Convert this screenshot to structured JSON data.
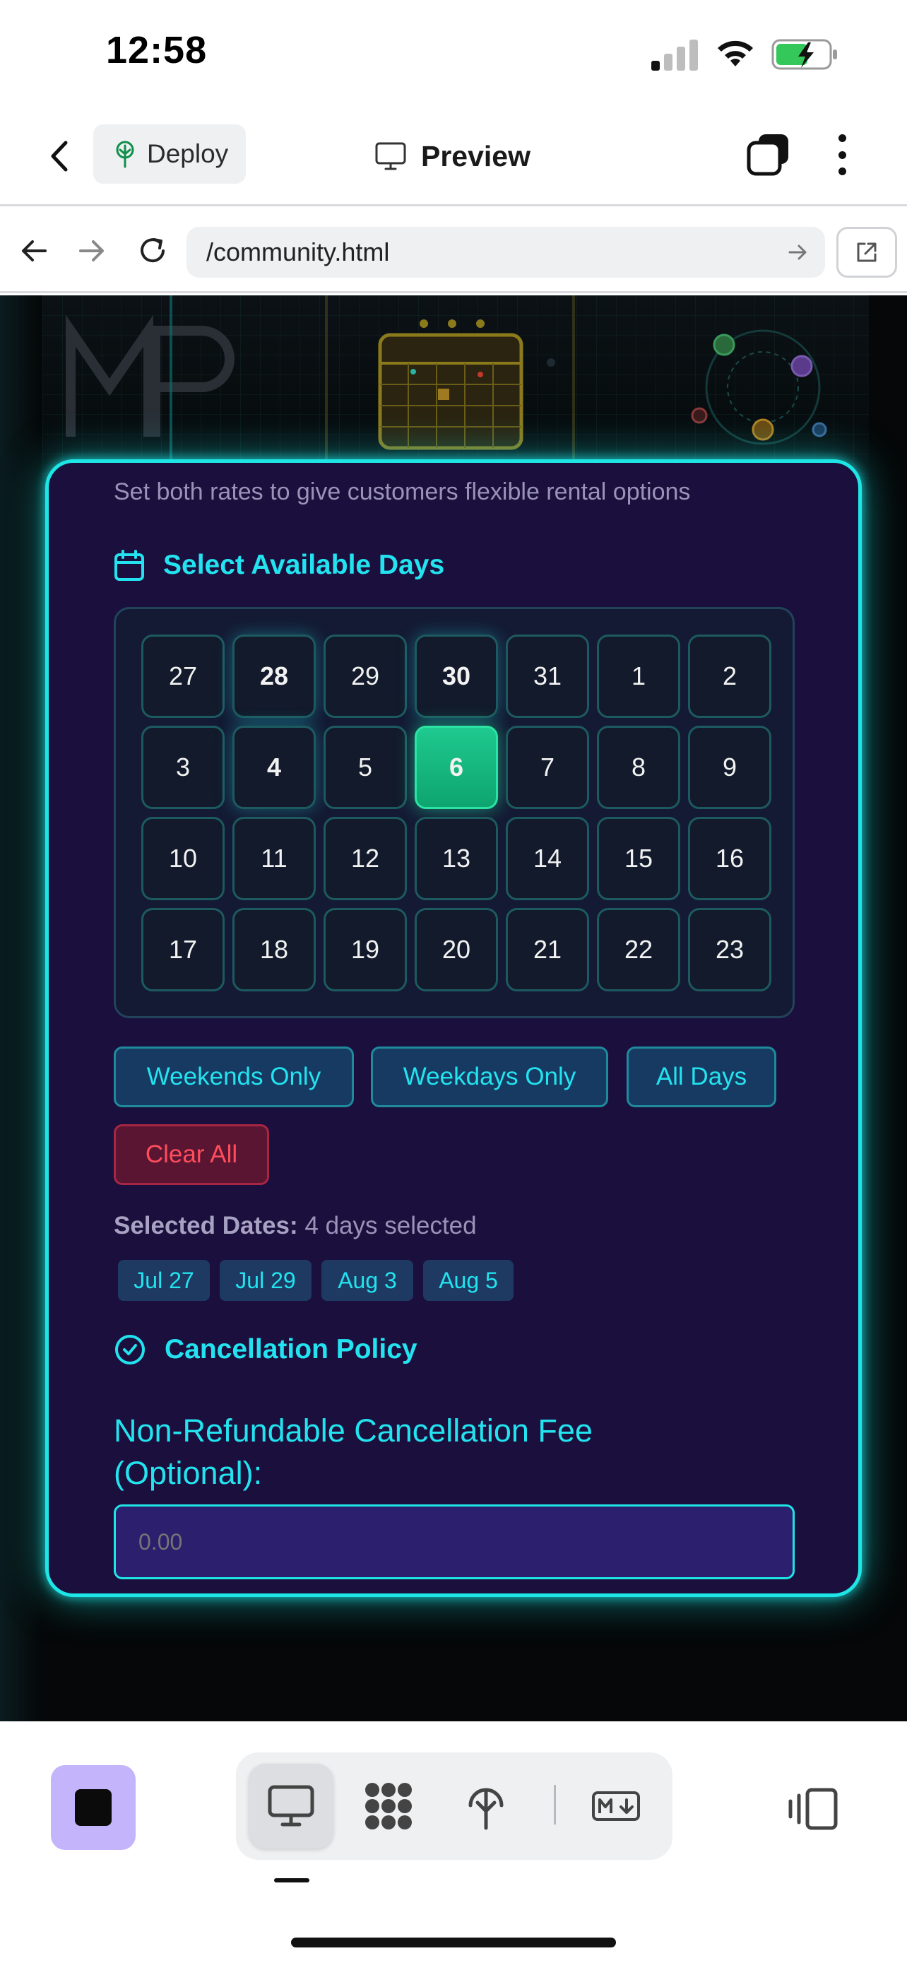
{
  "status_bar": {
    "time": "12:58"
  },
  "app_header": {
    "deploy_label": "Deploy",
    "title": "Preview"
  },
  "url_bar": {
    "url": "/community.html"
  },
  "card": {
    "hint": "Set both rates to give customers flexible rental options",
    "days_section_title": "Select Available Days",
    "calendar": {
      "rows": [
        [
          {
            "label": "27",
            "state": "normal"
          },
          {
            "label": "28",
            "state": "highlight"
          },
          {
            "label": "29",
            "state": "normal"
          },
          {
            "label": "30",
            "state": "highlight"
          },
          {
            "label": "31",
            "state": "normal"
          },
          {
            "label": "1",
            "state": "normal"
          },
          {
            "label": "2",
            "state": "normal"
          }
        ],
        [
          {
            "label": "3",
            "state": "normal"
          },
          {
            "label": "4",
            "state": "highlight"
          },
          {
            "label": "5",
            "state": "normal"
          },
          {
            "label": "6",
            "state": "selected"
          },
          {
            "label": "7",
            "state": "normal"
          },
          {
            "label": "8",
            "state": "normal"
          },
          {
            "label": "9",
            "state": "normal"
          }
        ],
        [
          {
            "label": "10",
            "state": "normal"
          },
          {
            "label": "11",
            "state": "normal"
          },
          {
            "label": "12",
            "state": "normal"
          },
          {
            "label": "13",
            "state": "normal"
          },
          {
            "label": "14",
            "state": "normal"
          },
          {
            "label": "15",
            "state": "normal"
          },
          {
            "label": "16",
            "state": "normal"
          }
        ],
        [
          {
            "label": "17",
            "state": "normal"
          },
          {
            "label": "18",
            "state": "normal"
          },
          {
            "label": "19",
            "state": "normal"
          },
          {
            "label": "20",
            "state": "normal"
          },
          {
            "label": "21",
            "state": "normal"
          },
          {
            "label": "22",
            "state": "normal"
          },
          {
            "label": "23",
            "state": "normal"
          }
        ]
      ]
    },
    "quick_buttons": {
      "weekends": "Weekends Only",
      "weekdays": "Weekdays Only",
      "all_days": "All Days",
      "clear_all": "Clear All"
    },
    "selected_dates": {
      "label": "Selected Dates:",
      "summary": "4 days selected",
      "tags": [
        "Jul 27",
        "Jul 29",
        "Aug 3",
        "Aug 5"
      ]
    },
    "cancellation_title": "Cancellation Policy",
    "fee_label": "Non-Refundable Cancellation Fee (Optional):",
    "fee_placeholder": "0.00"
  },
  "colors": {
    "accent_cyan": "#1ee6e6",
    "card_bg": "#1b0f3d",
    "selected_green": "#12b57d",
    "danger_red": "#ff4d5a"
  }
}
